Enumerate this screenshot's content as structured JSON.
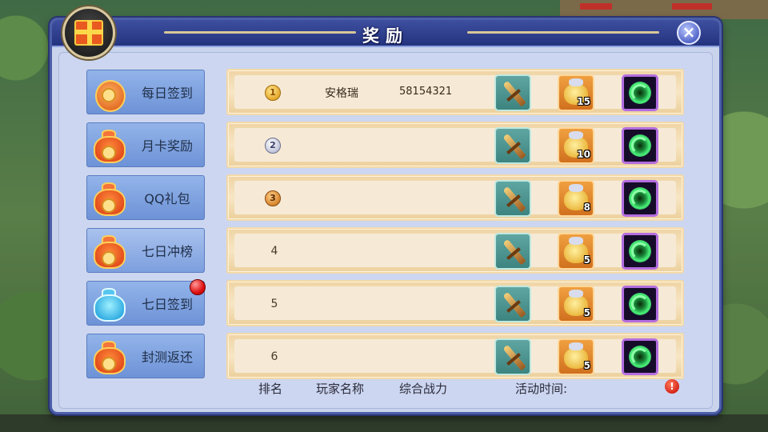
{
  "dialog": {
    "title": "奖励",
    "close_icon": "close-icon",
    "gift_icon": "gift-box-icon"
  },
  "sidebar": {
    "tabs": [
      {
        "label": "每日签到",
        "icon": "orange-coin-icon"
      },
      {
        "label": "月卡奖励",
        "icon": "red-bag-icon"
      },
      {
        "label": "QQ礼包",
        "icon": "red-bag-icon"
      },
      {
        "label": "七日冲榜",
        "icon": "red-bag-icon",
        "active": true
      },
      {
        "label": "七日签到",
        "icon": "blue-bag-icon",
        "has_notification": true
      },
      {
        "label": "封测返还",
        "icon": "red-bag-icon"
      }
    ]
  },
  "rankings": [
    {
      "rank": "1",
      "medal": "gold",
      "player": "安格瑞",
      "power": "58154321",
      "items": [
        {
          "icon": "dagger-icon"
        },
        {
          "icon": "coin-bag-icon",
          "count": "15"
        },
        {
          "icon": "green-swirl-icon"
        }
      ]
    },
    {
      "rank": "2",
      "medal": "silver",
      "player": "",
      "power": "",
      "items": [
        {
          "icon": "dagger-icon"
        },
        {
          "icon": "coin-bag-icon",
          "count": "10"
        },
        {
          "icon": "green-swirl-icon"
        }
      ]
    },
    {
      "rank": "3",
      "medal": "bronze",
      "player": "",
      "power": "",
      "items": [
        {
          "icon": "dagger-icon"
        },
        {
          "icon": "coin-bag-icon",
          "count": "8"
        },
        {
          "icon": "green-swirl-icon"
        }
      ]
    },
    {
      "rank": "4",
      "medal": "",
      "player": "",
      "power": "",
      "items": [
        {
          "icon": "dagger-icon"
        },
        {
          "icon": "coin-bag-icon",
          "count": "5"
        },
        {
          "icon": "green-swirl-icon"
        }
      ]
    },
    {
      "rank": "5",
      "medal": "",
      "player": "",
      "power": "",
      "items": [
        {
          "icon": "dagger-icon"
        },
        {
          "icon": "coin-bag-icon",
          "count": "5"
        },
        {
          "icon": "green-swirl-icon"
        }
      ]
    },
    {
      "rank": "6",
      "medal": "",
      "player": "",
      "power": "",
      "items": [
        {
          "icon": "dagger-icon"
        },
        {
          "icon": "coin-bag-icon",
          "count": "5"
        },
        {
          "icon": "green-swirl-icon"
        }
      ]
    }
  ],
  "footer": {
    "rank_label": "排名",
    "player_label": "玩家名称",
    "power_label": "综合战力",
    "time_label": "活动时间:",
    "info_icon": "info-icon"
  },
  "colors": {
    "header_blue": "#24337e",
    "row_beige": "#f6ead6",
    "tab_blue": "#7d9fde",
    "notification_red": "#e01010"
  }
}
